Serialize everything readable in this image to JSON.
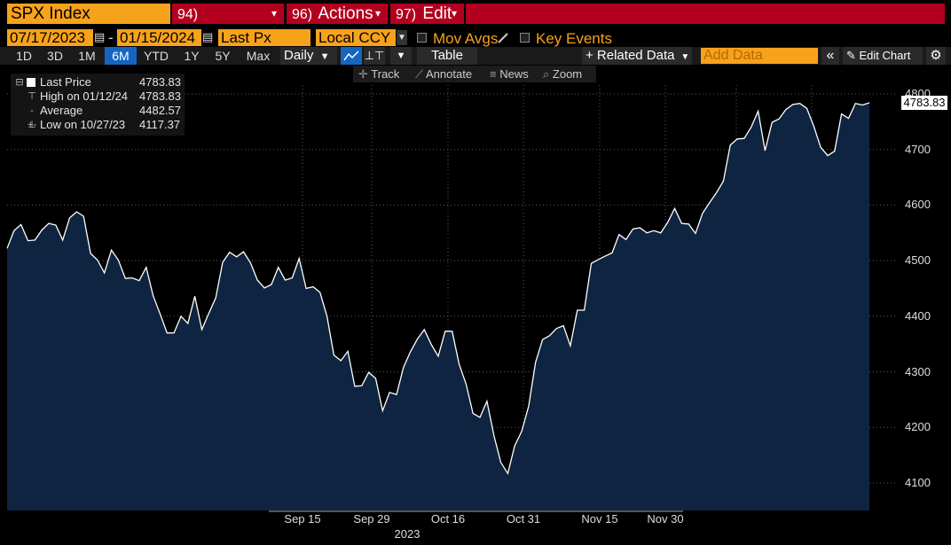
{
  "toolbar": {
    "ticker": "SPX Index",
    "menu1_num": "94)",
    "menu2_num": "96)",
    "menu2_label": "Actions",
    "menu3_num": "97)",
    "menu3_label": "Edit",
    "caret": "▾"
  },
  "controls": {
    "start_date": "07/17/2023",
    "date_sep": "-",
    "end_date": "01/15/2024",
    "field": "Last Px",
    "currency": "Local CCY",
    "mov_avgs": "Mov Avgs",
    "key_events": "Key Events"
  },
  "timeframes": [
    "1D",
    "3D",
    "1M",
    "6M",
    "YTD",
    "1Y",
    "5Y",
    "Max"
  ],
  "active_timeframe": "6M",
  "frequency": "Daily",
  "table_label": "Table",
  "related_data": "+ Related Data",
  "add_data_placeholder": "Add Data",
  "edit_chart": "Edit Chart",
  "tools": {
    "track": "Track",
    "annotate": "Annotate",
    "news": "News",
    "zoom": "Zoom"
  },
  "legend": {
    "last_price_label": "Last Price",
    "last_price_value": "4783.83",
    "high_label": "High on 01/12/24",
    "high_value": "4783.83",
    "average_label": "Average",
    "average_value": "4482.57",
    "low_label": "Low on 10/27/23",
    "low_value": "4117.37"
  },
  "last_price_badge": "4783.83",
  "colors": {
    "accent": "#f7a21b",
    "menu_red": "#b3001e",
    "fill": "#0e2440",
    "line": "#ffffff"
  },
  "chart_data": {
    "type": "area",
    "title": "",
    "xlabel": "",
    "ylabel": "",
    "ylim": [
      4080,
      4820
    ],
    "yticks": [
      4100,
      4200,
      4300,
      4400,
      4500,
      4600,
      4700,
      4800
    ],
    "xtick_labels": [
      "Sep 15",
      "Sep 29",
      "Oct 16",
      "Oct 31",
      "Nov 15",
      "Nov 30"
    ],
    "year_label": "2023",
    "series": [
      {
        "values": [
          4522,
          4554,
          4565,
          4536,
          4537,
          4555,
          4567,
          4564,
          4537,
          4577,
          4588,
          4580,
          4513,
          4501,
          4478,
          4519,
          4501,
          4468,
          4469,
          4464,
          4488,
          4437,
          4404,
          4370,
          4370,
          4400,
          4387,
          4436,
          4376,
          4405,
          4433,
          4497,
          4515,
          4507,
          4516,
          4496,
          4465,
          4451,
          4457,
          4488,
          4465,
          4469,
          4504,
          4450,
          4453,
          4443,
          4400,
          4330,
          4320,
          4337,
          4274,
          4275,
          4299,
          4288,
          4230,
          4263,
          4259,
          4308,
          4336,
          4359,
          4376,
          4349,
          4328,
          4373,
          4373,
          4314,
          4278,
          4225,
          4218,
          4247,
          4186,
          4137,
          4117,
          4167,
          4193,
          4238,
          4317,
          4358,
          4365,
          4378,
          4383,
          4347,
          4411,
          4411,
          4495,
          4502,
          4508,
          4514,
          4547,
          4538,
          4557,
          4559,
          4550,
          4554,
          4550,
          4569,
          4594,
          4567,
          4566,
          4549,
          4585,
          4604,
          4622,
          4643,
          4708,
          4719,
          4720,
          4740,
          4769,
          4698,
          4749,
          4755,
          4772,
          4781,
          4783,
          4774,
          4742,
          4704,
          4689,
          4697,
          4764,
          4756,
          4783,
          4780,
          4784
        ]
      }
    ]
  }
}
